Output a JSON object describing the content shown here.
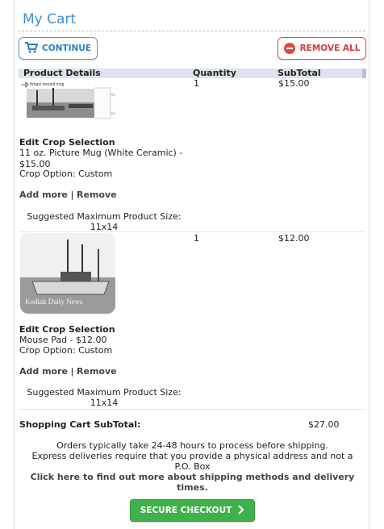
{
  "cart": {
    "title": "My Cart",
    "continue_label": "CONTINUE",
    "remove_all_label": "REMOVE ALL"
  },
  "table": {
    "headers": [
      "Product Details",
      "Quantity",
      "SubTotal"
    ]
  },
  "items": [
    {
      "image_caption": "Wraps around mug",
      "quantity": "1",
      "subtotal": "$15.00",
      "edit_label": "Edit Crop Selection",
      "name": "11 oz. Picture Mug (White Ceramic) - $15.00",
      "crop_option": "Crop Option: Custom",
      "add_more": "Add more",
      "separator": "|",
      "remove": "Remove",
      "suggested_label": "Suggested Maximum Product Size:",
      "suggested_size": "11x14"
    },
    {
      "image_watermark": "Kodiak Daily News",
      "quantity": "1",
      "subtotal": "$12.00",
      "edit_label": "Edit Crop Selection",
      "name": "Mouse Pad - $12.00",
      "crop_option": "Crop Option: Custom",
      "add_more": "Add more",
      "separator": "|",
      "remove": "Remove",
      "suggested_label": "Suggested Maximum Product Size:",
      "suggested_size": "11x14"
    }
  ],
  "summary": {
    "subtotal_label": "Shopping Cart SubTotal:",
    "subtotal_value": "$27.00",
    "note_line1": "Orders typically take 24-48 hours to process before shipping.",
    "note_line2": "Express deliveries require that you provide a physical address and not a P.O. Box",
    "shipping_link": "Click here to find out more about shipping methods and delivery times.",
    "checkout_label": "SECURE CHECKOUT"
  },
  "colors": {
    "title": "#3a8fd8",
    "continue": "#2a7fc8",
    "remove": "#d33c3c",
    "checkout": "#3fb04a",
    "header_bg": "#dde3ee"
  }
}
